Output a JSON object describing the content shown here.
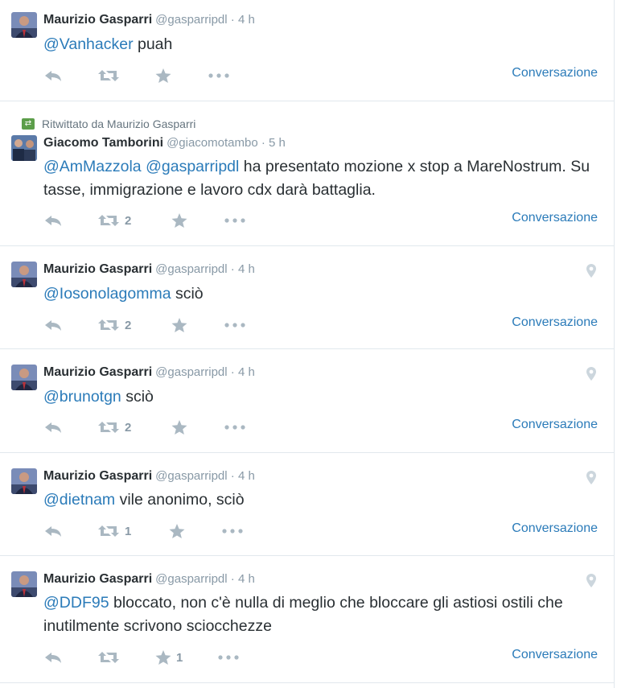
{
  "colors": {
    "link": "#2b7bb9",
    "text": "#292f33",
    "muted": "#8899a6",
    "action": "#aab8c2",
    "retweet_green": "#5c9e4a"
  },
  "tweets": [
    {
      "name": "Maurizio Gasparri",
      "handle": "@gasparripdl",
      "time": "4 h",
      "mention": "@Vanhacker",
      "text": " puah",
      "retweets": "",
      "favorites": "",
      "conversation": "Conversazione",
      "location_pin": false
    },
    {
      "retweeted_by": "Ritwittato da Maurizio Gasparri",
      "name": "Giacomo Tamborini",
      "handle": "@giacomotambo",
      "time": "5 h",
      "mention": "@AmMazzola",
      "mention2": "@gasparripdl",
      "text": " ha presentato mozione x stop a MareNostrum. Su tasse, immigrazione e lavoro cdx darà battaglia.",
      "retweets": "2",
      "favorites": "",
      "conversation": "Conversazione",
      "location_pin": false
    },
    {
      "name": "Maurizio Gasparri",
      "handle": "@gasparripdl",
      "time": "4 h",
      "mention": "@Iosonolagomma",
      "text": " sciò",
      "retweets": "2",
      "favorites": "",
      "conversation": "Conversazione",
      "location_pin": true
    },
    {
      "name": "Maurizio Gasparri",
      "handle": "@gasparripdl",
      "time": "4 h",
      "mention": "@brunotgn",
      "text": " sciò",
      "retweets": "2",
      "favorites": "",
      "conversation": "Conversazione",
      "location_pin": true
    },
    {
      "name": "Maurizio Gasparri",
      "handle": "@gasparripdl",
      "time": "4 h",
      "mention": "@dietnam",
      "text": " vile anonimo, sciò",
      "retweets": "1",
      "favorites": "",
      "conversation": "Conversazione",
      "location_pin": true
    },
    {
      "name": "Maurizio Gasparri",
      "handle": "@gasparripdl",
      "time": "4 h",
      "mention": "@DDF95",
      "text": " bloccato, non c'è nulla di meglio che bloccare gli astiosi ostili che inutilmente scrivono sciocchezze",
      "retweets": "",
      "favorites": "1",
      "conversation": "Conversazione",
      "location_pin": true
    }
  ]
}
